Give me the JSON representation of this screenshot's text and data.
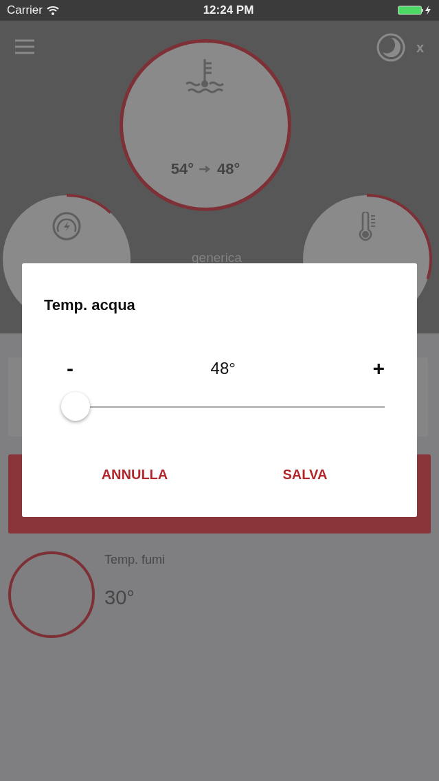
{
  "status_bar": {
    "carrier": "Carrier",
    "time": "12:24 PM"
  },
  "header": {
    "close": "x"
  },
  "gauges": [
    {
      "kind": "main",
      "reading": "54°",
      "target": "48°",
      "level": 1
    },
    {
      "kind": "power",
      "level": 0.12
    },
    {
      "kind": "thermometer",
      "level": 0.3
    }
  ],
  "mode_label": "generica",
  "smoke": {
    "label": "Temp. fumi",
    "reading": "30°"
  },
  "dialog": {
    "title": "Temp. acqua",
    "minus": "-",
    "value": "48°",
    "plus": "+",
    "level": 0,
    "buttons": [
      {
        "label": "ANNULLA"
      },
      {
        "label": "SALVA"
      }
    ]
  }
}
